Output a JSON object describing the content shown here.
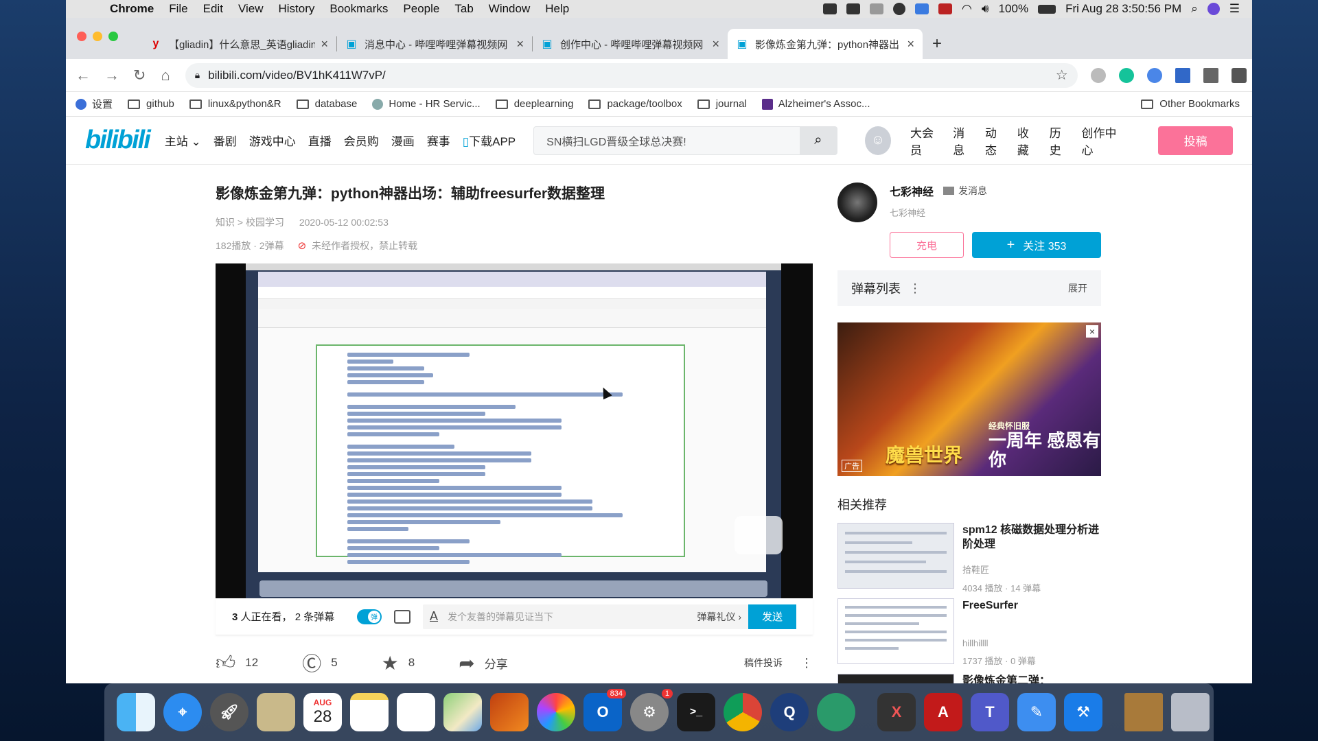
{
  "menubar": {
    "app": "Chrome",
    "items": [
      "File",
      "Edit",
      "View",
      "History",
      "Bookmarks",
      "People",
      "Tab",
      "Window",
      "Help"
    ],
    "battery": "100%",
    "datetime": "Fri Aug 28  3:50:56 PM"
  },
  "tabs": [
    {
      "title": "【gliadin】什么意思_英语gliadin",
      "icon": "youdao-y-icon"
    },
    {
      "title": "消息中心 - 哔哩哔哩弹幕视频网",
      "icon": "bilibili-tv-icon"
    },
    {
      "title": "创作中心 - 哔哩哔哩弹幕视频网",
      "icon": "bilibili-tv-icon"
    },
    {
      "title": "影像炼金第九弹：python神器出",
      "icon": "bilibili-tv-icon"
    }
  ],
  "address": {
    "url": "bilibili.com/video/BV1hK411W7vP/"
  },
  "bookmarks": [
    "设置",
    "github",
    "linux&python&R",
    "database",
    "Home - HR Servic...",
    "deeplearning",
    "package/toolbox",
    "journal",
    "Alzheimer's Assoc..."
  ],
  "other_bookmarks": "Other Bookmarks",
  "site": {
    "logo": "bilibili",
    "nav": [
      "主站",
      "番剧",
      "游戏中心",
      "直播",
      "会员购",
      "漫画",
      "赛事",
      "下载APP"
    ],
    "search_placeholder": "SN横扫LGD晋级全球总决赛!",
    "top_links": [
      "大会员",
      "消息",
      "动态",
      "收藏",
      "历史",
      "创作中心"
    ],
    "upload": "投稿"
  },
  "video": {
    "title": "影像炼金第九弹：python神器出场：辅助freesurfer数据整理",
    "category": "知识 > 校园学习",
    "date": "2020-05-12 00:02:53",
    "stats": "182播放 · 2弹幕",
    "copyright": "未经作者授权，禁止转载"
  },
  "danmaku_bar": {
    "watching_count": "3",
    "watching_text": "人正在看，",
    "danmaku_count": "2 条弹幕",
    "toggle_label": "弹",
    "placeholder": "发个友善的弹幕见证当下",
    "etiquette": "弹幕礼仪",
    "send": "发送"
  },
  "actions": {
    "like": "12",
    "coin": "5",
    "fav": "8",
    "share": "分享",
    "report": "稿件投诉"
  },
  "uploader": {
    "name": "七彩神经",
    "message": "发消息",
    "desc": "七彩神经",
    "charge": "充电",
    "follow": "关注 353"
  },
  "danmaku_list": {
    "title": "弹幕列表",
    "expand": "展开"
  },
  "ad": {
    "tag": "广告",
    "title": "魔兽世界",
    "sub_small": "经典怀旧服",
    "sub": "一周年 感恩有你"
  },
  "recommend": {
    "title": "相关推荐",
    "items": [
      {
        "title": "spm12 核磁数据处理分析进阶处理",
        "uploader": "拾鞋匠",
        "stats": "4034 播放 · 14 弹幕"
      },
      {
        "title": "FreeSurfer",
        "uploader": "hillhillll",
        "stats": "1737 播放 · 0 弹幕"
      },
      {
        "title": "影像炼金第二弹：freesurfer结构像批处理（第一步...",
        "uploader": "",
        "stats": ""
      }
    ]
  },
  "dock": {
    "calendar_month": "AUG",
    "calendar_day": "28",
    "outlook_badge": "834",
    "prefs_badge": "1"
  },
  "colors": {
    "bilibili_blue": "#00a1d6",
    "bilibili_pink": "#fb7299"
  }
}
